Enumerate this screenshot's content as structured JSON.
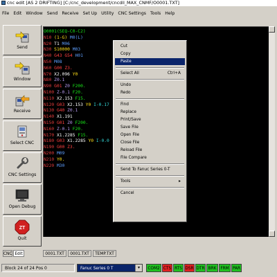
{
  "window": {
    "title": "cnc edit [AS 2 DRIFTING] [C:/cnc_development/cncdll_MAX_CNMF/O0001.TXT]"
  },
  "menu": [
    "File",
    "Edit",
    "Window",
    "Send",
    "Receive",
    "Set Up",
    "Utility",
    "CNC Settings",
    "Tools",
    "Help"
  ],
  "toolbar": {
    "send": "Send",
    "window": "Window",
    "receive": "Receive",
    "select_cnc": "Select CNC",
    "cnc_settings": "CNC Settings",
    "open_debug": "Open Debug",
    "quit": "Quit"
  },
  "editor": {
    "lines": [
      [
        {
          "t": "O0001",
          "c": "o"
        },
        {
          "t": "(SEQ-C0-C2)",
          "c": "o"
        }
      ],
      [
        {
          "t": "N10 ",
          "c": "n"
        },
        {
          "t": "(1-G) ",
          "c": "c"
        },
        {
          "t": "M0(L)",
          "c": "m"
        }
      ],
      [
        {
          "t": "N20 ",
          "c": "n"
        },
        {
          "t": "T1 ",
          "c": "x"
        },
        {
          "t": "M06",
          "c": "m"
        }
      ],
      [
        {
          "t": "N30 ",
          "c": "n"
        },
        {
          "t": "S10000 ",
          "c": "c"
        },
        {
          "t": "M03",
          "c": "m"
        }
      ],
      [
        {
          "t": "N40 ",
          "c": "n"
        },
        {
          "t": "G43 ",
          "c": "k"
        },
        {
          "t": "G54 ",
          "c": "k"
        },
        {
          "t": "H01",
          "c": "m"
        }
      ],
      [
        {
          "t": "N50 ",
          "c": "n"
        },
        {
          "t": "M08",
          "c": "m"
        }
      ],
      [
        {
          "t": "N60 ",
          "c": "n"
        },
        {
          "t": "G00 ",
          "c": "k"
        },
        {
          "t": "Z3.",
          "c": "k"
        }
      ],
      [
        {
          "t": "N70 ",
          "c": "n"
        },
        {
          "t": "X2.096 ",
          "c": "x"
        },
        {
          "t": "Y0",
          "c": "c"
        }
      ],
      [
        {
          "t": "N80 ",
          "c": "n"
        },
        {
          "t": "Z0.1",
          "c": "z"
        }
      ],
      [
        {
          "t": "N90 ",
          "c": "n"
        },
        {
          "t": "G01 ",
          "c": "k"
        },
        {
          "t": "Z0 ",
          "c": "z"
        },
        {
          "t": "F200.",
          "c": "f"
        }
      ],
      [
        {
          "t": "N100 ",
          "c": "n"
        },
        {
          "t": "Z-0.1 ",
          "c": "z"
        },
        {
          "t": "F20.",
          "c": "f"
        }
      ],
      [
        {
          "t": "N110 ",
          "c": "n"
        },
        {
          "t": "X2.153 ",
          "c": "x"
        },
        {
          "t": "F15.",
          "c": "f"
        }
      ],
      [
        {
          "t": "N120 ",
          "c": "n"
        },
        {
          "t": "G03 ",
          "c": "k"
        },
        {
          "t": "X2.153 ",
          "c": "x"
        },
        {
          "t": "Y0 ",
          "c": "c"
        },
        {
          "t": "I-0.17",
          "c": "i"
        }
      ],
      [
        {
          "t": "N130 ",
          "c": "n"
        },
        {
          "t": "G40 ",
          "c": "k"
        },
        {
          "t": "Z0.1",
          "c": "z"
        }
      ],
      [
        {
          "t": "N140 ",
          "c": "n"
        },
        {
          "t": "X1.191",
          "c": "x"
        }
      ],
      [
        {
          "t": "N150 ",
          "c": "n"
        },
        {
          "t": "G01 ",
          "c": "k"
        },
        {
          "t": "Z0 ",
          "c": "z"
        },
        {
          "t": "F200.",
          "c": "f"
        }
      ],
      [
        {
          "t": "N160 ",
          "c": "n"
        },
        {
          "t": "Z-0.1 ",
          "c": "z"
        },
        {
          "t": "F20.",
          "c": "f"
        }
      ],
      [
        {
          "t": "N170 ",
          "c": "n"
        },
        {
          "t": "X1.2285 ",
          "c": "x"
        },
        {
          "t": "F15.",
          "c": "f"
        }
      ],
      [
        {
          "t": "N180 ",
          "c": "n"
        },
        {
          "t": "G03 ",
          "c": "k"
        },
        {
          "t": "X1.2285 ",
          "c": "x"
        },
        {
          "t": "Y0 ",
          "c": "c"
        },
        {
          "t": "I-0.0",
          "c": "i"
        }
      ],
      [
        {
          "t": "N190 ",
          "c": "n"
        },
        {
          "t": "G00 ",
          "c": "k"
        },
        {
          "t": "Z3.",
          "c": "k"
        }
      ],
      [
        {
          "t": "N200 ",
          "c": "n"
        },
        {
          "t": "M09",
          "c": "m"
        }
      ],
      [
        {
          "t": "N210 ",
          "c": "n"
        },
        {
          "t": "Y0.",
          "c": "c"
        }
      ],
      [
        {
          "t": "N220 ",
          "c": "n"
        },
        {
          "t": "M30",
          "c": "m"
        }
      ]
    ]
  },
  "context_menu": {
    "items": [
      {
        "label": "Cut",
        "shortcut": ""
      },
      {
        "label": "Copy",
        "shortcut": ""
      },
      {
        "label": "Paste",
        "shortcut": "",
        "selected": true
      },
      {
        "sep": true
      },
      {
        "label": "Select All",
        "shortcut": "Ctrl+A"
      },
      {
        "sep": true
      },
      {
        "label": "Undo",
        "shortcut": ""
      },
      {
        "label": "Redo",
        "shortcut": ""
      },
      {
        "sep": true
      },
      {
        "label": "Find",
        "shortcut": ""
      },
      {
        "label": "Replace",
        "shortcut": ""
      },
      {
        "label": "Print/Save",
        "shortcut": ""
      },
      {
        "label": "Save File",
        "shortcut": ""
      },
      {
        "label": "Open File",
        "shortcut": ""
      },
      {
        "label": "Close File",
        "shortcut": ""
      },
      {
        "label": "Reload File",
        "shortcut": ""
      },
      {
        "label": "File Compare",
        "shortcut": ""
      },
      {
        "sep": true
      },
      {
        "label": "Send To Fanuc Series 0-T",
        "shortcut": ""
      },
      {
        "sep": true
      },
      {
        "label": "Tools",
        "shortcut": "▸"
      },
      {
        "sep": true
      },
      {
        "label": "Cancel",
        "shortcut": ""
      }
    ]
  },
  "tabs": [
    "CNC",
    "Edit",
    "0001.TXT",
    "0001.TXT",
    "TEMP.TXT"
  ],
  "status": {
    "block": "Block 24 of 24 Pos 0",
    "machine": "Fanuc Series 0 T",
    "leds": [
      {
        "label": "COM2",
        "color": "#20c020"
      },
      {
        "label": "CTS",
        "color": "#e02020"
      },
      {
        "label": "RTS",
        "color": "#20c020"
      },
      {
        "label": "DSR",
        "color": "#e02020"
      },
      {
        "label": "DTR",
        "color": "#20c020"
      },
      {
        "label": "BRK",
        "color": "#20c020"
      },
      {
        "label": "FRM",
        "color": "#20c020"
      },
      {
        "label": "PAR",
        "color": "#20c020"
      }
    ]
  }
}
